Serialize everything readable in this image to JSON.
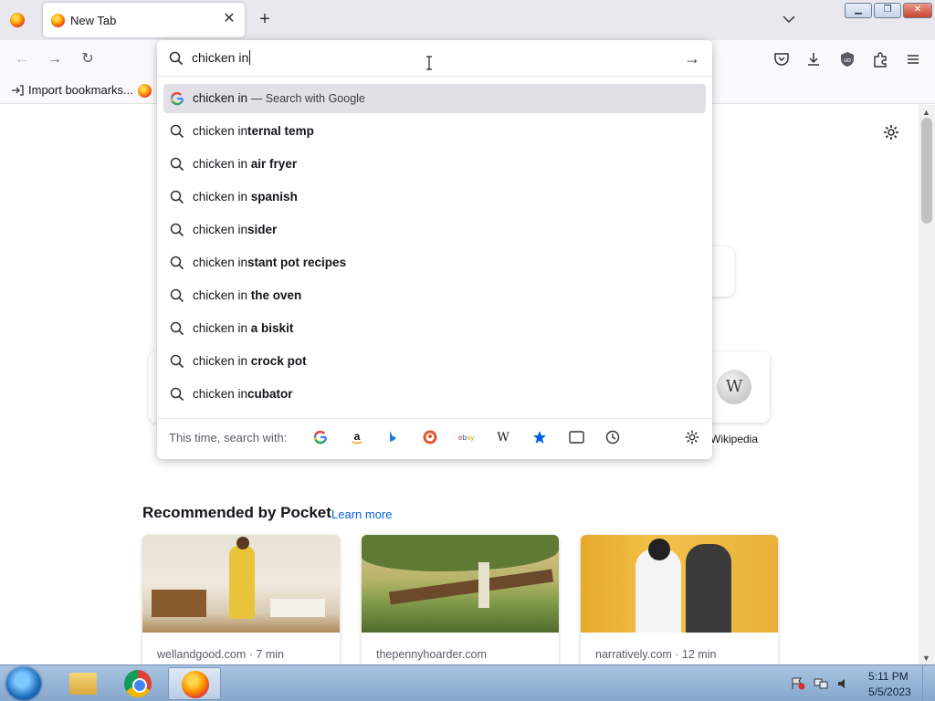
{
  "tabs": [
    {
      "title": "New Tab",
      "close_glyph": "✕"
    }
  ],
  "tabstrip": {
    "new_tab_glyph": "+",
    "list_all_tabs_icon": "chevron-down-icon"
  },
  "window_controls": {
    "minimize": "▁",
    "maximize": "❐",
    "close": "✕"
  },
  "navbar": {
    "back_glyph": "←",
    "forward_glyph": "→",
    "reload_glyph": "↻"
  },
  "bookmarks": {
    "import_label": "Import bookmarks..."
  },
  "urlbar": {
    "typed_text": "chicken in",
    "go_glyph": "→",
    "suggestions": [
      {
        "typed": "chicken in",
        "completion": "",
        "action": "— Search with Google",
        "icon": "google-icon",
        "selected": true
      },
      {
        "typed": "chicken in",
        "completion": "ternal temp",
        "icon": "search-icon"
      },
      {
        "typed": "chicken in",
        "completion": " air fryer",
        "icon": "search-icon"
      },
      {
        "typed": "chicken in",
        "completion": " spanish",
        "icon": "search-icon"
      },
      {
        "typed": "chicken in",
        "completion": "sider",
        "icon": "search-icon"
      },
      {
        "typed": "chicken in",
        "completion": "stant pot recipes",
        "icon": "search-icon"
      },
      {
        "typed": "chicken in",
        "completion": " the oven",
        "icon": "search-icon"
      },
      {
        "typed": "chicken in",
        "completion": " a biskit",
        "icon": "search-icon"
      },
      {
        "typed": "chicken in",
        "completion": " crock pot",
        "icon": "search-icon"
      },
      {
        "typed": "chicken in",
        "completion": "cubator",
        "icon": "search-icon"
      }
    ],
    "oneoff_label": "This time, search with:",
    "oneoff_engines": [
      "google-icon",
      "amazon-icon",
      "bing-icon",
      "duckduckgo-icon",
      "ebay-icon",
      "wikipedia-icon",
      "bookmarks-star-icon",
      "tabs-icon",
      "history-icon"
    ]
  },
  "page": {
    "top_site_label": "Wikipedia",
    "wiki_glyph": "W",
    "pocket_heading": "Recommended by Pocket",
    "pocket_learn_more": "Learn more",
    "stories": [
      {
        "source": "wellandgood.com · 7 min"
      },
      {
        "source": "thepennyhoarder.com"
      },
      {
        "source": "narratively.com · 12 min"
      }
    ]
  },
  "taskbar": {
    "time": "5:11 PM",
    "date": "5/5/2023",
    "apps": [
      "windows-explorer",
      "google-chrome",
      "firefox"
    ],
    "active_app": "firefox"
  },
  "colors": {
    "tabstrip_bg": "#e9e8ee",
    "accent_link": "#0061e0",
    "selected_row": "#e0e0e6",
    "taskbar": "#a9c4e0"
  }
}
